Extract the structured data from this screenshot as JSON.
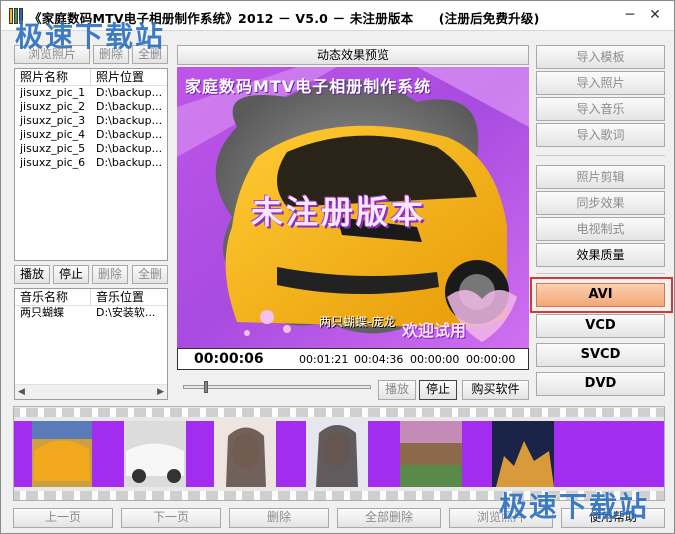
{
  "window": {
    "title": "《家庭数码MTV电子相册制作系统》2012 － V5.0 － 未注册版本　　(注册后免费升级)",
    "min_glyph": "─",
    "close_glyph": "✕"
  },
  "watermark": {
    "text_top": "极速下载站",
    "text_bottom": "极速下载站"
  },
  "photos": {
    "buttons": {
      "browse": "浏览照片",
      "delete": "删除",
      "delete_all": "全删"
    },
    "col_name": "照片名称",
    "col_path": "照片位置",
    "rows": [
      {
        "name": "jisuxz_pic_1",
        "path": "D:\\backup..."
      },
      {
        "name": "jisuxz_pic_2",
        "path": "D:\\backup..."
      },
      {
        "name": "jisuxz_pic_3",
        "path": "D:\\backup..."
      },
      {
        "name": "jisuxz_pic_4",
        "path": "D:\\backup..."
      },
      {
        "name": "jisuxz_pic_5",
        "path": "D:\\backup..."
      },
      {
        "name": "jisuxz_pic_6",
        "path": "D:\\backup..."
      }
    ]
  },
  "music": {
    "buttons": {
      "play": "播放",
      "stop": "停止",
      "delete": "删除",
      "delete_all": "全删"
    },
    "col_name": "音乐名称",
    "col_path": "音乐位置",
    "rows": [
      {
        "name": "两只蝴蝶",
        "path": "D:\\安装软..."
      }
    ]
  },
  "preview": {
    "header": "动态效果预览",
    "overlay_title": "家庭数码MTV电子相册制作系统",
    "overlay_unreg": "未注册版本",
    "song_caption": "两只蝴蝶-庞龙",
    "welcome": "欢迎试用",
    "current_time": "00:00:06",
    "times": [
      "00:01:21",
      "00:04:36",
      "00:00:00",
      "00:00:00"
    ]
  },
  "player": {
    "play": "播放",
    "stop": "停止",
    "buy": "购买软件"
  },
  "right": {
    "import_template": "导入模板",
    "import_photo": "导入照片",
    "import_music": "导入音乐",
    "import_lyrics": "导入歌词",
    "photo_crop": "照片剪辑",
    "sync_effect": "同步效果",
    "tv_format": "电视制式",
    "effect_quality": "效果质量",
    "avi": "AVI",
    "vcd": "VCD",
    "svcd": "SVCD",
    "dvd": "DVD"
  },
  "bottom": {
    "prev": "上一页",
    "next": "下一页",
    "delete": "删除",
    "delete_all": "全部删除",
    "browse_photo": "浏览照片",
    "help": "使用帮助"
  },
  "colors": {
    "accent_purple": "#9b3fd8",
    "selected_red": "#d23a3a",
    "avi_orange": "#f6b48a"
  }
}
